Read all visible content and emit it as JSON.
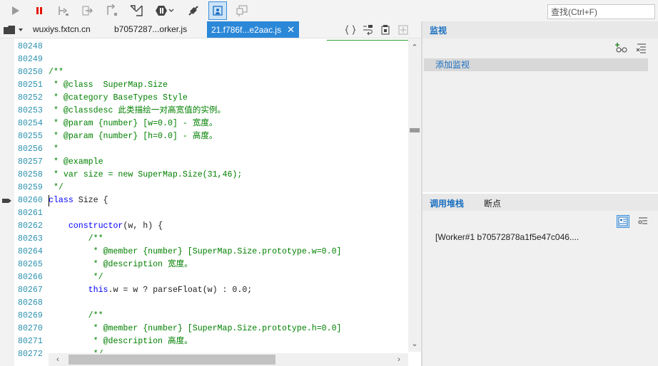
{
  "toolbar": {
    "buttons": [
      {
        "name": "continue-icon"
      },
      {
        "name": "break-all-icon"
      },
      {
        "name": "step-over-icon"
      },
      {
        "name": "step-into-icon"
      },
      {
        "name": "step-out-icon"
      },
      {
        "name": "step-into-next-call-icon"
      },
      {
        "name": "exception-behavior-icon"
      },
      {
        "name": "disconnect-icon"
      },
      {
        "name": "debug-just-my-code-icon"
      },
      {
        "name": "clear-console-icon"
      }
    ],
    "search_placeholder": "查找(Ctrl+F)"
  },
  "tabs": [
    {
      "label": "wuxiys.fxtcn.cn",
      "active": false
    },
    {
      "label": "b7057287...orker.js",
      "active": false
    },
    {
      "label": "21.f786f...e2aac.js",
      "active": true,
      "close": "✕"
    }
  ],
  "editor": {
    "lines": [
      {
        "n": "80248",
        "text": ""
      },
      {
        "n": "80249",
        "text": ""
      },
      {
        "n": "80250",
        "text": "/**"
      },
      {
        "n": "80251",
        "text": " * @class  SuperMap.Size"
      },
      {
        "n": "80252",
        "text": " * @category BaseTypes Style"
      },
      {
        "n": "80253",
        "text": " * @classdesc 此类描绘一对高宽值的实例。"
      },
      {
        "n": "80254",
        "text": " * @param {number} [w=0.0] - 宽度。"
      },
      {
        "n": "80255",
        "text": " * @param {number} [h=0.0] - 高度。"
      },
      {
        "n": "80256",
        "text": " *"
      },
      {
        "n": "80257",
        "text": " * @example"
      },
      {
        "n": "80258",
        "text": " * var size = new SuperMap.Size(31,46);"
      },
      {
        "n": "80259",
        "text": " */"
      },
      {
        "n": "80260",
        "kw": "class",
        "text": " Size {"
      },
      {
        "n": "80261",
        "text": ""
      },
      {
        "n": "80262",
        "kw": "    constructor",
        "text": "(w, h) {"
      },
      {
        "n": "80263",
        "text": "        /**"
      },
      {
        "n": "80264",
        "text": "         * @member {number} [SuperMap.Size.prototype.w=0.0]"
      },
      {
        "n": "80265",
        "text": "         * @description 宽度。"
      },
      {
        "n": "80266",
        "text": "         */"
      },
      {
        "n": "80267",
        "kw": "        this",
        "text": ".w = w ? parseFloat(w) : 0.0;"
      },
      {
        "n": "80268",
        "text": ""
      },
      {
        "n": "80269",
        "text": "        /**"
      },
      {
        "n": "80270",
        "text": "         * @member {number} [SuperMap.Size.prototype.h=0.0]"
      },
      {
        "n": "80271",
        "text": "         * @description 高度。"
      },
      {
        "n": "80272",
        "text": "         */"
      }
    ],
    "comment_lines": [
      2,
      3,
      4,
      5,
      6,
      7,
      8,
      9,
      10,
      11,
      15,
      16,
      17,
      18,
      21,
      22,
      23,
      24
    ],
    "current_line": "80260"
  },
  "watch": {
    "title": "监视",
    "add_label": "添加监视"
  },
  "callstack": {
    "tab_label": "调用堆栈",
    "breakpoints_label": "断点",
    "rows": [
      "[Worker#1 b70572878a1f5e47c046...."
    ]
  },
  "colors": {
    "accent": "#2b88d8",
    "line_number": "#2b91af",
    "comment": "#008000",
    "keyword": "#0000ff"
  }
}
